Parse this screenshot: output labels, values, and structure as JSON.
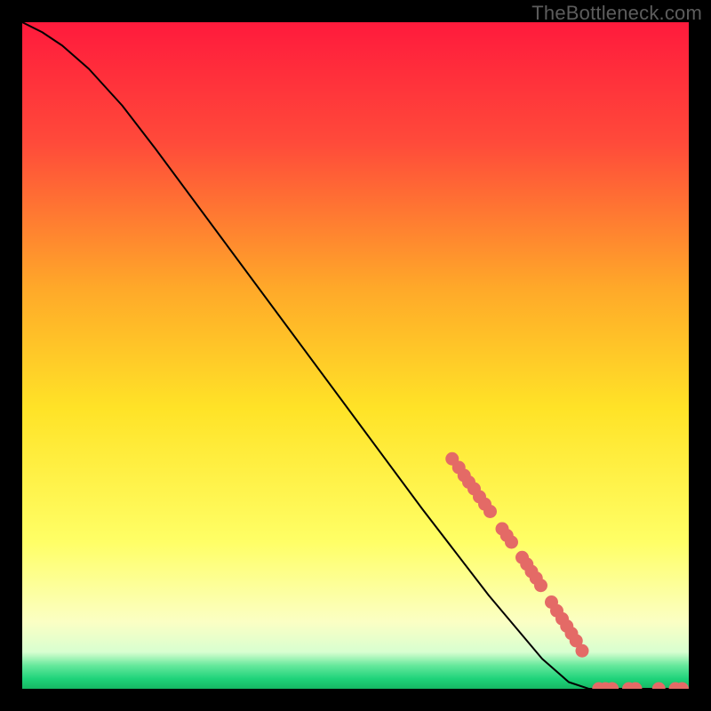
{
  "watermark": "TheBottleneck.com",
  "chart_data": {
    "type": "line",
    "title": "",
    "xlabel": "",
    "ylabel": "",
    "xlim": [
      0,
      100
    ],
    "ylim": [
      0,
      100
    ],
    "gradient_stops": [
      {
        "offset": 0.0,
        "color": "#ff1a3c"
      },
      {
        "offset": 0.18,
        "color": "#ff4a3a"
      },
      {
        "offset": 0.4,
        "color": "#ffa929"
      },
      {
        "offset": 0.58,
        "color": "#ffe327"
      },
      {
        "offset": 0.78,
        "color": "#ffff66"
      },
      {
        "offset": 0.9,
        "color": "#fbffc4"
      },
      {
        "offset": 0.945,
        "color": "#d8ffd0"
      },
      {
        "offset": 0.965,
        "color": "#66e89c"
      },
      {
        "offset": 0.985,
        "color": "#1fd37a"
      },
      {
        "offset": 1.0,
        "color": "#16b763"
      }
    ],
    "curve": [
      {
        "x": 0.0,
        "y": 100.0
      },
      {
        "x": 3.0,
        "y": 98.5
      },
      {
        "x": 6.0,
        "y": 96.5
      },
      {
        "x": 10.0,
        "y": 93.0
      },
      {
        "x": 15.0,
        "y": 87.5
      },
      {
        "x": 20.0,
        "y": 81.0
      },
      {
        "x": 30.0,
        "y": 67.5
      },
      {
        "x": 40.0,
        "y": 54.0
      },
      {
        "x": 50.0,
        "y": 40.5
      },
      {
        "x": 60.0,
        "y": 27.0
      },
      {
        "x": 70.0,
        "y": 14.0
      },
      {
        "x": 78.0,
        "y": 4.5
      },
      {
        "x": 82.0,
        "y": 1.0
      },
      {
        "x": 85.0,
        "y": 0.0
      },
      {
        "x": 100.0,
        "y": 0.0
      }
    ],
    "markers": [
      {
        "x": 64.5,
        "y": 34.5
      },
      {
        "x": 65.5,
        "y": 33.2
      },
      {
        "x": 66.3,
        "y": 32.0
      },
      {
        "x": 67.0,
        "y": 31.0
      },
      {
        "x": 67.8,
        "y": 30.0
      },
      {
        "x": 68.6,
        "y": 28.8
      },
      {
        "x": 69.4,
        "y": 27.7
      },
      {
        "x": 70.2,
        "y": 26.6
      },
      {
        "x": 72.0,
        "y": 24.0
      },
      {
        "x": 72.7,
        "y": 23.0
      },
      {
        "x": 73.4,
        "y": 22.0
      },
      {
        "x": 75.0,
        "y": 19.7
      },
      {
        "x": 75.7,
        "y": 18.7
      },
      {
        "x": 76.4,
        "y": 17.6
      },
      {
        "x": 77.1,
        "y": 16.6
      },
      {
        "x": 77.8,
        "y": 15.5
      },
      {
        "x": 79.4,
        "y": 13.0
      },
      {
        "x": 80.2,
        "y": 11.7
      },
      {
        "x": 81.0,
        "y": 10.5
      },
      {
        "x": 81.7,
        "y": 9.4
      },
      {
        "x": 82.4,
        "y": 8.3
      },
      {
        "x": 83.1,
        "y": 7.2
      },
      {
        "x": 84.0,
        "y": 5.7
      },
      {
        "x": 86.5,
        "y": 0.0
      },
      {
        "x": 87.5,
        "y": 0.0
      },
      {
        "x": 88.5,
        "y": 0.0
      },
      {
        "x": 91.0,
        "y": 0.0
      },
      {
        "x": 92.0,
        "y": 0.0
      },
      {
        "x": 95.5,
        "y": 0.0
      },
      {
        "x": 98.0,
        "y": 0.0
      },
      {
        "x": 99.0,
        "y": 0.0
      }
    ],
    "marker_style": {
      "r": 7,
      "fill": "#e46a66",
      "stroke": "#e46a66"
    },
    "line_style": {
      "stroke": "#000000",
      "width": 2
    }
  }
}
